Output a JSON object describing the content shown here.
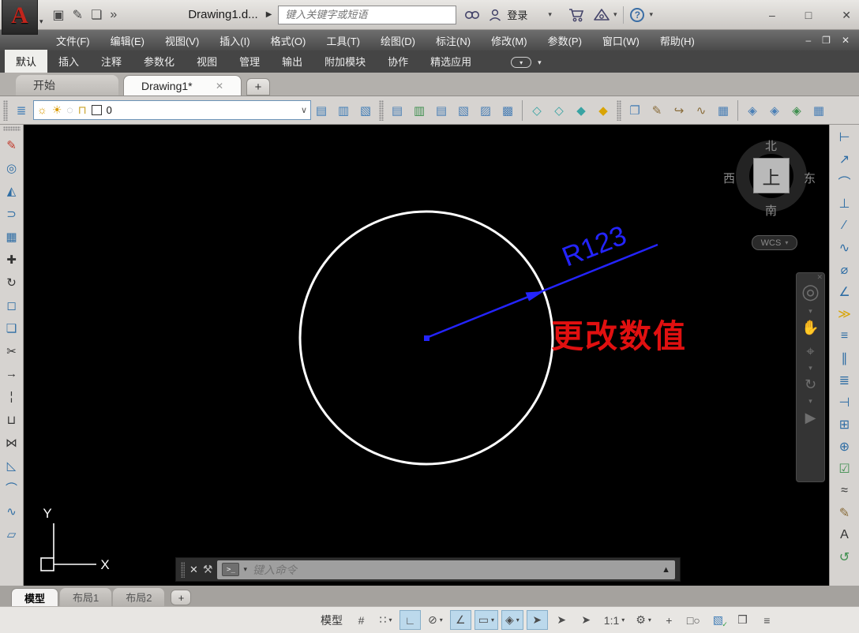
{
  "window": {
    "logo_letter": "A",
    "logo_chevron": "▾",
    "doc_title": "Drawing1.d...",
    "title_arrow": "▶",
    "search_placeholder": "键入关键字或短语",
    "signin_label": "登录",
    "help_glyph": "?",
    "quick_access_icons": [
      {
        "name": "qsave-icon",
        "glyph": "▣"
      },
      {
        "name": "save-as-icon",
        "glyph": "✎"
      },
      {
        "name": "plot-icon",
        "glyph": "❏"
      },
      {
        "name": "more-tools-icon",
        "glyph": "»"
      }
    ],
    "accent_blue": "#3b6ea5",
    "min_glyph": "–",
    "max_glyph": "□",
    "close_glyph": "✕",
    "mdi_min_glyph": "–",
    "mdi_restore_glyph": "❐",
    "mdi_close_glyph": "✕"
  },
  "menu_bar": [
    "文件(F)",
    "编辑(E)",
    "视图(V)",
    "插入(I)",
    "格式(O)",
    "工具(T)",
    "绘图(D)",
    "标注(N)",
    "修改(M)",
    "参数(P)",
    "窗口(W)",
    "帮助(H)"
  ],
  "ribbon_tabs": [
    {
      "name": "tab-default",
      "label": "默认",
      "active": true
    },
    {
      "name": "tab-insert",
      "label": "插入"
    },
    {
      "name": "tab-annotate",
      "label": "注释"
    },
    {
      "name": "tab-parametric",
      "label": "参数化"
    },
    {
      "name": "tab-view",
      "label": "视图"
    },
    {
      "name": "tab-manage",
      "label": "管理"
    },
    {
      "name": "tab-output",
      "label": "输出"
    },
    {
      "name": "tab-addins",
      "label": "附加模块"
    },
    {
      "name": "tab-collaborate",
      "label": "协作"
    },
    {
      "name": "tab-featured-apps",
      "label": "精选应用"
    }
  ],
  "file_tabs": {
    "start_label": "开始",
    "active_doc_label": "Drawing1*",
    "close_glyph": "✕",
    "new_tab_glyph": "+"
  },
  "layer_toolbar": {
    "properties_glyph": "≣",
    "combo_icons": [
      {
        "name": "layer-on-icon",
        "glyph": "☼",
        "color": "#d99a00"
      },
      {
        "name": "layer-thaw-icon",
        "glyph": "☀",
        "color": "#d99a00"
      },
      {
        "name": "layer-freeze-vp-icon",
        "glyph": "◌",
        "color": "#9aa0a6"
      },
      {
        "name": "layer-unlock-icon",
        "glyph": "⊓",
        "color": "#c9a227"
      }
    ],
    "current_layer": "0",
    "combo_chevron": "∨",
    "group_a": [
      {
        "name": "make-object-layer-current-icon",
        "glyph": "▤",
        "color": "#3f7cb6"
      },
      {
        "name": "layer-match-icon",
        "glyph": "▥",
        "color": "#3f7cb6"
      },
      {
        "name": "layer-previous-icon",
        "glyph": "▧",
        "color": "#3f7cb6"
      }
    ],
    "group_b": [
      {
        "name": "layer-isolate-icon",
        "glyph": "▤",
        "color": "#4a7fb5"
      },
      {
        "name": "layer-unisolate-icon",
        "glyph": "▥",
        "color": "#3f8f4f"
      },
      {
        "name": "layer-freeze-icon",
        "glyph": "▤",
        "color": "#4a7fb5"
      },
      {
        "name": "layer-off-icon",
        "glyph": "▧",
        "color": "#4a7fb5"
      },
      {
        "name": "layer-walk-icon",
        "glyph": "▨",
        "color": "#4a7fb5"
      },
      {
        "name": "layer-vp-freeze-icon",
        "glyph": "▩",
        "color": "#4a7fb5"
      }
    ],
    "group_c": [
      {
        "name": "freeze-layer-icon",
        "glyph": "◇",
        "color": "#38a3a3"
      },
      {
        "name": "off-layer-icon",
        "glyph": "◇",
        "color": "#38a3a3"
      },
      {
        "name": "lock-layer-icon",
        "glyph": "◆",
        "color": "#38a3a3"
      },
      {
        "name": "unlock-layer-icon",
        "glyph": "◆",
        "color": "#d9a404"
      }
    ],
    "group_d": [
      {
        "name": "copy-nested-objects-icon",
        "glyph": "❐",
        "color": "#4a7fb5"
      },
      {
        "name": "clip-edit-icon",
        "glyph": "✎",
        "color": "#8a6d3b"
      },
      {
        "name": "edit-polyline-icon",
        "glyph": "↪",
        "color": "#8a6d3b"
      },
      {
        "name": "edit-spline-icon",
        "glyph": "∿",
        "color": "#8a6d3b"
      },
      {
        "name": "edit-array-icon",
        "glyph": "▦",
        "color": "#4a7fb5"
      }
    ],
    "group_e": [
      {
        "name": "edit-attribute-icon",
        "glyph": "◈",
        "color": "#4a7fb5"
      },
      {
        "name": "block-attribute-icon",
        "glyph": "◈",
        "color": "#4a7fb5"
      },
      {
        "name": "sync-attribute-icon",
        "glyph": "◈",
        "color": "#3f8f4f"
      },
      {
        "name": "attribute-manager-icon",
        "glyph": "▦",
        "color": "#4a7fb5"
      }
    ]
  },
  "left_toolbar": [
    {
      "name": "erase-icon",
      "glyph": "✎",
      "color": "#c0392b"
    },
    {
      "name": "copy-icon",
      "glyph": "◎",
      "color": "#2e6da4"
    },
    {
      "name": "mirror-icon",
      "glyph": "◭",
      "color": "#2e6da4"
    },
    {
      "name": "offset-icon",
      "glyph": "⊃",
      "color": "#2e6da4"
    },
    {
      "name": "array-icon",
      "glyph": "▦",
      "color": "#2e6da4"
    },
    {
      "name": "move-icon",
      "glyph": "✚",
      "color": "#333333"
    },
    {
      "name": "rotate-icon",
      "glyph": "↻",
      "color": "#333333"
    },
    {
      "name": "scale-icon",
      "glyph": "◻",
      "color": "#2e6da4"
    },
    {
      "name": "stretch-icon",
      "glyph": "❏",
      "color": "#2e6da4"
    },
    {
      "name": "trim-icon",
      "glyph": "✂",
      "color": "#333333"
    },
    {
      "name": "extend-icon",
      "glyph": "→",
      "color": "#333333"
    },
    {
      "name": "break-at-point-icon",
      "glyph": "¦",
      "color": "#333333"
    },
    {
      "name": "break-icon",
      "glyph": "⊔",
      "color": "#333333"
    },
    {
      "name": "join-icon",
      "glyph": "⋈",
      "color": "#333333"
    },
    {
      "name": "chamfer-icon",
      "glyph": "◺",
      "color": "#2e6da4"
    },
    {
      "name": "fillet-icon",
      "glyph": "⌒",
      "color": "#2e6da4"
    },
    {
      "name": "spline-icon",
      "glyph": "∿",
      "color": "#2e6da4"
    },
    {
      "name": "region-icon",
      "glyph": "▱",
      "color": "#2e6da4"
    }
  ],
  "right_toolbar": [
    {
      "name": "dim-linear-icon",
      "glyph": "⊢",
      "color": "#2e6da4"
    },
    {
      "name": "dim-aligned-icon",
      "glyph": "↗",
      "color": "#2e6da4"
    },
    {
      "name": "dim-arc-length-icon",
      "glyph": "⌒",
      "color": "#2e6da4"
    },
    {
      "name": "dim-ordinate-icon",
      "glyph": "⊥",
      "color": "#2e6da4"
    },
    {
      "name": "dim-radius-icon",
      "glyph": "∕",
      "color": "#2e6da4"
    },
    {
      "name": "dim-jogged-icon",
      "glyph": "∿",
      "color": "#2e6da4"
    },
    {
      "name": "dim-diameter-icon",
      "glyph": "⌀",
      "color": "#2e6da4"
    },
    {
      "name": "dim-angular-icon",
      "glyph": "∠",
      "color": "#2e6da4"
    },
    {
      "name": "quick-dimension-icon",
      "glyph": "≫",
      "color": "#d9a404"
    },
    {
      "name": "dim-baseline-icon",
      "glyph": "≡",
      "color": "#2e6da4"
    },
    {
      "name": "dim-continue-icon",
      "glyph": "∥",
      "color": "#2e6da4"
    },
    {
      "name": "dim-space-icon",
      "glyph": "≣",
      "color": "#2e6da4"
    },
    {
      "name": "dim-break-icon",
      "glyph": "⊣",
      "color": "#2e6da4"
    },
    {
      "name": "tolerance-icon",
      "glyph": "⊞",
      "color": "#2e6da4"
    },
    {
      "name": "center-mark-icon",
      "glyph": "⊕",
      "color": "#2e6da4"
    },
    {
      "name": "dim-inspect-icon",
      "glyph": "☑",
      "color": "#3f8f4f"
    },
    {
      "name": "dim-jog-line-icon",
      "glyph": "≈",
      "color": "#333333"
    },
    {
      "name": "dim-edit-icon",
      "glyph": "✎",
      "color": "#8a6d3b"
    },
    {
      "name": "dim-text-edit-icon",
      "glyph": "A",
      "color": "#333333"
    },
    {
      "name": "dim-update-icon",
      "glyph": "↺",
      "color": "#3f8f4f"
    }
  ],
  "canvas": {
    "dimension_label": "R123",
    "dimension_color": "#2424ff",
    "annotation_text": "更改数值",
    "annotation_color": "#e01010",
    "circle_color": "#ffffff",
    "viewcube": {
      "north": "北",
      "south": "南",
      "west": "西",
      "east": "东",
      "top": "上"
    },
    "wcs_label": "WCS",
    "wcs_chevron": "▾",
    "ucs": {
      "x": "X",
      "y": "Y"
    },
    "navbar_icons": [
      {
        "name": "navigation-wheel-icon",
        "glyph": "◎",
        "cls": "wheel"
      },
      {
        "name": "chevron-down-icon",
        "glyph": "▾",
        "cls": "small"
      },
      {
        "name": "pan-icon",
        "glyph": "✋"
      },
      {
        "name": "zoom-icon",
        "glyph": "⌖"
      },
      {
        "name": "chevron-down-icon",
        "glyph": "▾",
        "cls": "small"
      },
      {
        "name": "orbit-icon",
        "glyph": "↻"
      },
      {
        "name": "chevron-down-icon",
        "glyph": "▾",
        "cls": "small"
      },
      {
        "name": "showmotion-icon",
        "glyph": "▶"
      }
    ],
    "navbar_close_glyph": "✕",
    "command_line": {
      "close_glyph": "✕",
      "wrench_glyph": "⚒",
      "prompt_glyph": ">_",
      "chevron": "▾",
      "placeholder": "键入命令",
      "expand_glyph": "▲"
    }
  },
  "layout_tabs": {
    "items": [
      {
        "name": "tab-model",
        "label": "模型",
        "active": true
      },
      {
        "name": "tab-layout1",
        "label": "布局1"
      },
      {
        "name": "tab-layout2",
        "label": "布局2"
      }
    ],
    "add_glyph": "+"
  },
  "status_bar": {
    "model_label": "模型",
    "buttons": [
      {
        "name": "grid-display-button",
        "glyph": "#"
      },
      {
        "name": "snap-mode-button",
        "glyph": "∷",
        "dropdown": true
      },
      {
        "name": "ortho-button",
        "glyph": "∟",
        "active": true
      },
      {
        "name": "polar-tracking-button",
        "glyph": "⊘",
        "dropdown": true
      },
      {
        "name": "osnap-tracking-button",
        "glyph": "∠",
        "active": true
      },
      {
        "name": "dynamic-input-button",
        "glyph": "▭",
        "active": true,
        "dropdown": true
      },
      {
        "name": "object-snap-button",
        "glyph": "◈",
        "active": true,
        "dropdown": true
      },
      {
        "name": "selection-cycling-button",
        "glyph": "➤",
        "active": true
      },
      {
        "name": "annotation-monitor-button",
        "glyph": "➤"
      },
      {
        "name": "annotation-visibility-button",
        "glyph": "➤"
      },
      {
        "name": "annotation-scale-button",
        "glyph": "1:1",
        "dropdown": true
      },
      {
        "name": "workspace-switching-button",
        "glyph": "⚙",
        "dropdown": true
      },
      {
        "name": "crosshair-button",
        "glyph": "+"
      },
      {
        "name": "isolate-objects-button",
        "glyph": "□○"
      },
      {
        "name": "graphics-performance-button",
        "glyph": "▧",
        "cls": "gpu"
      },
      {
        "name": "clean-screen-button",
        "glyph": "❒"
      },
      {
        "name": "customization-button",
        "glyph": "≡"
      }
    ]
  }
}
